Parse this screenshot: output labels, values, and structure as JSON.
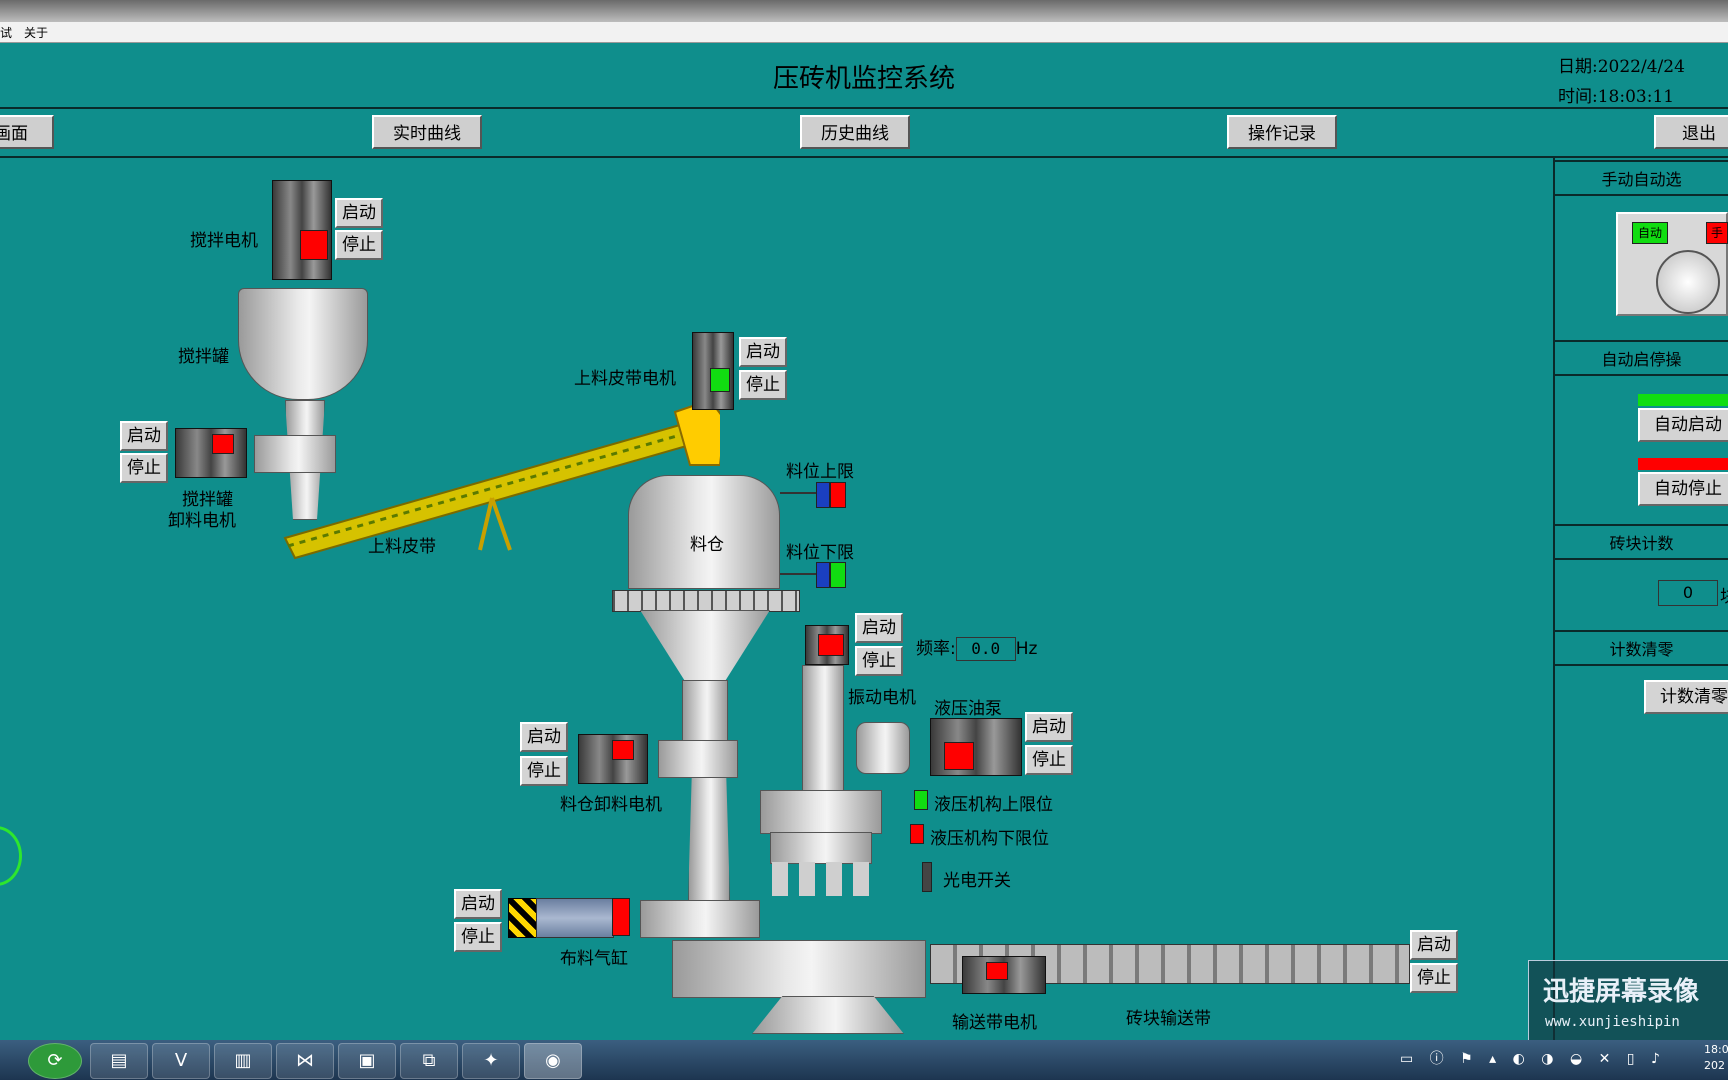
{
  "window": {
    "title": "压砖机监控系统",
    "date_label": "日期:",
    "date": "2022/4/24",
    "time_label": "时间:",
    "time": "18:03:11"
  },
  "menu": {
    "items": [
      "试",
      "关于"
    ]
  },
  "nav": {
    "main_screen": "画面",
    "realtime": "实时曲线",
    "history": "历史曲线",
    "oplog": "操作记录",
    "exit": "退出"
  },
  "mixer": {
    "motor_label": "搅拌电机",
    "tank_label": "搅拌罐",
    "discharge_motor_label_1": "搅拌罐",
    "discharge_motor_label_2": "卸料电机"
  },
  "belt": {
    "label": "上料皮带",
    "motor_label": "上料皮带电机"
  },
  "silo": {
    "label": "料仓",
    "upper_limit": "料位上限",
    "lower_limit": "料位下限",
    "discharge_motor_label": "料仓卸料电机"
  },
  "vibration": {
    "motor_label": "振动电机",
    "freq_label": "频率:",
    "freq_value": "0.0",
    "freq_unit": "Hz"
  },
  "hydraulic": {
    "pump_label": "液压油泵",
    "upper_limit": "液压机构上限位",
    "lower_limit": "液压机构下限位",
    "photo_switch": "光电开关"
  },
  "cylinder": {
    "label": "布料气缸"
  },
  "conveyor": {
    "motor_label": "输送带电机",
    "belt_label": "砖块输送带"
  },
  "buttons": {
    "start": "启动",
    "stop": "停止"
  },
  "right_panel": {
    "mode_head": "手动自动选",
    "auto": "自动",
    "manual": "手",
    "auto_ops_head": "自动启停操",
    "auto_start": "自动启动",
    "auto_stop": "自动停止",
    "count_head": "砖块计数",
    "count_value": "0",
    "count_unit": "块",
    "clear_head": "计数清零",
    "clear_btn": "计数清零"
  },
  "watermark": {
    "line1": "迅捷屏幕录像",
    "line2": "www.xunjieshipin"
  },
  "colors": {
    "bg": "#0f8e8c",
    "running": "#11dd11",
    "stopped": "#ff0000"
  },
  "clock": {
    "time": "18:0",
    "year": "202"
  }
}
